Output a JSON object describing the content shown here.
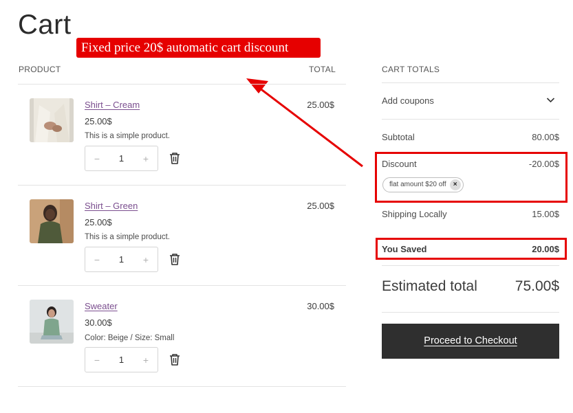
{
  "page": {
    "title": "Cart"
  },
  "annotation": {
    "text": "Fixed price 20$ automatic cart discount",
    "color": "#e60000"
  },
  "table": {
    "product_header": "PRODUCT",
    "total_header": "TOTAL"
  },
  "items": [
    {
      "name": "Shirt – Cream",
      "price": "25.00$",
      "meta": "This is a simple product.",
      "quantity": "1",
      "total": "25.00$",
      "image": "cream-shirt-photo"
    },
    {
      "name": "Shirt – Green",
      "price": "25.00$",
      "meta": "This is a simple product.",
      "quantity": "1",
      "total": "25.00$",
      "image": "green-shirt-photo"
    },
    {
      "name": "Sweater",
      "price": "30.00$",
      "meta": "Color: Beige / Size: Small",
      "quantity": "1",
      "total": "30.00$",
      "image": "sweater-photo"
    }
  ],
  "stepper": {
    "minus": "−",
    "plus": "+"
  },
  "totals": {
    "heading": "CART TOTALS",
    "coupons_label": "Add coupons",
    "subtotal_label": "Subtotal",
    "subtotal_value": "80.00$",
    "discount_label": "Discount",
    "discount_value": "-20.00$",
    "coupon_chip": "flat amount $20 off",
    "coupon_remove": "×",
    "shipping_label": "Shipping Locally",
    "shipping_value": "15.00$",
    "saved_label": "You Saved",
    "saved_value": "20.00$",
    "estimated_label": "Estimated total",
    "estimated_value": "75.00$",
    "checkout_label": "Proceed to Checkout"
  },
  "colors": {
    "link": "#7a4d8e",
    "highlight": "#e60000",
    "checkout_bg": "#2f2f2f"
  }
}
